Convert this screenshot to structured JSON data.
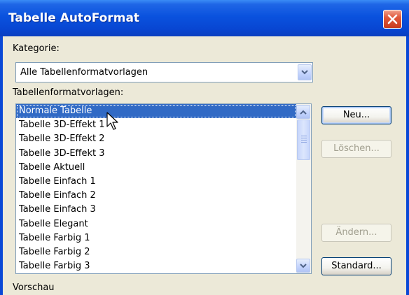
{
  "window": {
    "title": "Tabelle AutoFormat",
    "close_icon": "close-icon"
  },
  "kategorie": {
    "label": "Kategorie:",
    "value": "Alle Tabellenformatvorlagen"
  },
  "vorlagen": {
    "label": "Tabellenformatvorlagen:",
    "items": [
      "Normale Tabelle",
      "Tabelle 3D-Effekt 1",
      "Tabelle 3D-Effekt 2",
      "Tabelle 3D-Effekt 3",
      "Tabelle Aktuell",
      "Tabelle Einfach 1",
      "Tabelle Einfach 2",
      "Tabelle Einfach 3",
      "Tabelle Elegant",
      "Tabelle Farbig 1",
      "Tabelle Farbig 2",
      "Tabelle Farbig 3"
    ],
    "selected_index": 0
  },
  "buttons": {
    "neu": "Neu...",
    "loeschen": "Löschen...",
    "aendern": "Ändern...",
    "standard": "Standard..."
  },
  "vorschau": {
    "label": "Vorschau"
  },
  "colors": {
    "titlebar": "#0a52de",
    "selection": "#316ac5",
    "dialog_bg": "#ece9d8",
    "close": "#e0583a"
  }
}
